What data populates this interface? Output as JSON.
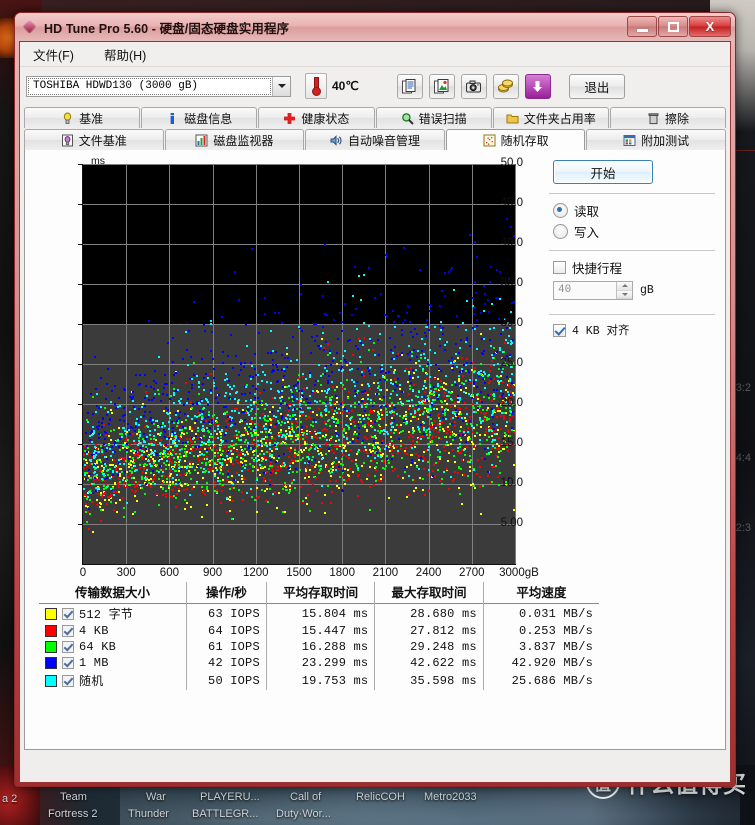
{
  "window": {
    "title": "HD Tune Pro 5.60 - 硬盘/固态硬盘实用程序",
    "app_icon": "hdtune-diamond-icon",
    "minimize_label": "最小化",
    "maximize_label": "最大化",
    "close_label": "X"
  },
  "menu": {
    "items": [
      {
        "label": "文件(F)"
      },
      {
        "label": "帮助(H)"
      }
    ]
  },
  "toolbar": {
    "drive": "TOSHIBA HDWD130 (3000 gB)",
    "temperature": "40℃",
    "buttons": [
      {
        "name": "copy-text-icon",
        "tip": "复制文本"
      },
      {
        "name": "copy-image-icon",
        "tip": "复制图像"
      },
      {
        "name": "screenshot-camera-icon",
        "tip": "截图"
      },
      {
        "name": "coins-icon",
        "tip": "捐赠"
      },
      {
        "name": "download-arrow-icon",
        "tip": "下载"
      }
    ],
    "exit_label": "退出"
  },
  "tabs": {
    "row1": [
      {
        "label": "基准",
        "icon": "lightbulb-icon",
        "active": false
      },
      {
        "label": "磁盘信息",
        "icon": "info-icon",
        "active": false
      },
      {
        "label": "健康状态",
        "icon": "red-cross-icon",
        "active": false
      },
      {
        "label": "错误扫描",
        "icon": "magnifier-icon",
        "active": false
      },
      {
        "label": "文件夹占用率",
        "icon": "folder-icon",
        "active": false
      },
      {
        "label": "擦除",
        "icon": "trash-icon",
        "active": false
      }
    ],
    "row2": [
      {
        "label": "文件基准",
        "icon": "file-bench-icon",
        "active": false
      },
      {
        "label": "磁盘监视器",
        "icon": "bar-chart-icon",
        "active": false
      },
      {
        "label": "自动噪音管理",
        "icon": "speaker-icon",
        "active": false
      },
      {
        "label": "随机存取",
        "icon": "random-access-icon",
        "active": true
      },
      {
        "label": "附加测试",
        "icon": "extra-test-icon",
        "active": false
      }
    ]
  },
  "controls": {
    "start_label": "开始",
    "mode": [
      {
        "label": "读取",
        "selected": true
      },
      {
        "label": "写入",
        "selected": false
      }
    ],
    "short_stroke": {
      "label": "快捷行程",
      "checked": false,
      "value": "40",
      "unit": "gB"
    },
    "align": {
      "label": "4 KB 对齐",
      "checked": true
    }
  },
  "chart_data": {
    "type": "scatter",
    "title": "",
    "xlabel": "gB",
    "ylabel": "ms",
    "xlim": [
      0,
      3000
    ],
    "ylim": [
      0,
      50
    ],
    "xticks": [
      "0",
      "300",
      "600",
      "900",
      "1200",
      "1500",
      "1800",
      "2100",
      "2400",
      "2700",
      "3000gB"
    ],
    "xtick_values": [
      0,
      300,
      600,
      900,
      1200,
      1500,
      1800,
      2100,
      2400,
      2700,
      3000
    ],
    "yticks": [
      "5.00",
      "10.0",
      "15.0",
      "20.0",
      "25.0",
      "30.0",
      "35.0",
      "40.0",
      "45.0",
      "50.0"
    ],
    "ytick_values": [
      5,
      10,
      15,
      20,
      25,
      30,
      35,
      40,
      45,
      50
    ],
    "grid": true,
    "plot_bg": "#000000",
    "shaded_region_color": "#3b3b3b",
    "shaded_region_top_ms": 30,
    "series": [
      {
        "name": "512 字节",
        "color": "#FFFF00",
        "mean_ms": 15.804,
        "max_ms": 28.68,
        "iops": 63,
        "speed_mbs": 0.031,
        "n": 760
      },
      {
        "name": "4 KB",
        "color": "#FF0000",
        "mean_ms": 15.447,
        "max_ms": 27.812,
        "iops": 64,
        "speed_mbs": 0.253,
        "n": 760
      },
      {
        "name": "64 KB",
        "color": "#00FF00",
        "mean_ms": 16.288,
        "max_ms": 29.248,
        "iops": 61,
        "speed_mbs": 3.837,
        "n": 760
      },
      {
        "name": "1 MB",
        "color": "#0000FF",
        "mean_ms": 23.299,
        "max_ms": 42.622,
        "iops": 42,
        "speed_mbs": 42.92,
        "n": 700
      },
      {
        "name": "随机",
        "color": "#00FFFF",
        "mean_ms": 19.753,
        "max_ms": 35.598,
        "iops": 50,
        "speed_mbs": 25.686,
        "n": 760
      }
    ]
  },
  "results_table": {
    "headers": [
      "传输数据大小",
      "操作/秒",
      "平均存取时间",
      "最大存取时间",
      "平均速度"
    ],
    "rows": [
      {
        "color": "#FFFF00",
        "checked": true,
        "size": "512 字节",
        "iops": "63 IOPS",
        "avg_access": "15.804 ms",
        "max_access": "28.680 ms",
        "avg_speed": "0.031 MB/s"
      },
      {
        "color": "#FF0000",
        "checked": true,
        "size": "4 KB",
        "iops": "64 IOPS",
        "avg_access": "15.447 ms",
        "max_access": "27.812 ms",
        "avg_speed": "0.253 MB/s"
      },
      {
        "color": "#00FF00",
        "checked": true,
        "size": "64 KB",
        "iops": "61 IOPS",
        "avg_access": "16.288 ms",
        "max_access": "29.248 ms",
        "avg_speed": "3.837 MB/s"
      },
      {
        "color": "#0000FF",
        "checked": true,
        "size": "1 MB",
        "iops": "42 IOPS",
        "avg_access": "23.299 ms",
        "max_access": "42.622 ms",
        "avg_speed": "42.920 MB/s"
      },
      {
        "color": "#00FFFF",
        "checked": true,
        "size": "随机",
        "iops": "50 IOPS",
        "avg_access": "19.753 ms",
        "max_access": "35.598 ms",
        "avg_speed": "25.686 MB/s"
      }
    ]
  },
  "desktop": {
    "icons": [
      {
        "label": "a 2"
      },
      {
        "label": "Team"
      },
      {
        "label": "Fortress 2"
      },
      {
        "label": "War"
      },
      {
        "label": "Thunder"
      },
      {
        "label": "PLAYERU..."
      },
      {
        "label": "BATTLEGR..."
      },
      {
        "label": "Call of"
      },
      {
        "label": "Duty·Wor..."
      },
      {
        "label": "RelicCOH"
      },
      {
        "label": "Metro2033"
      }
    ],
    "clock": [
      "3:2",
      "4:4",
      "2:3"
    ],
    "watermark": {
      "mark": "值",
      "text": "什么值得买"
    }
  }
}
